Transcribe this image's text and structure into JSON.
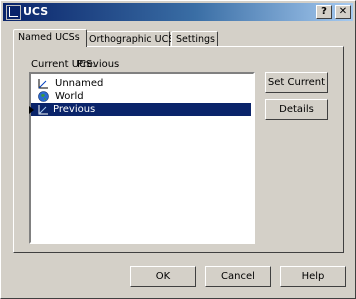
{
  "window": {
    "title": "UCS",
    "help_glyph": "?",
    "close_glyph": "✕"
  },
  "tabs": [
    {
      "label": "Named UCSs",
      "active": true
    },
    {
      "label": "Orthographic UCSs",
      "active": false
    },
    {
      "label": "Settings",
      "active": false
    }
  ],
  "current": {
    "label": "Current UCS:",
    "value": "Previous"
  },
  "list": {
    "items": [
      {
        "label": "Unnamed",
        "icon": "ucs-axis-icon",
        "selected": false
      },
      {
        "label": "World",
        "icon": "globe-icon",
        "selected": false
      },
      {
        "label": "Previous",
        "icon": "ucs-axis-icon",
        "selected": true
      }
    ]
  },
  "buttons": {
    "set_current": "Set Current",
    "details": "Details",
    "ok": "OK",
    "cancel": "Cancel",
    "help": "Help"
  },
  "colors": {
    "titlebar_start": "#0a246a",
    "titlebar_end": "#a6caf0",
    "selection": "#0a246a",
    "face": "#d4d0c8"
  }
}
